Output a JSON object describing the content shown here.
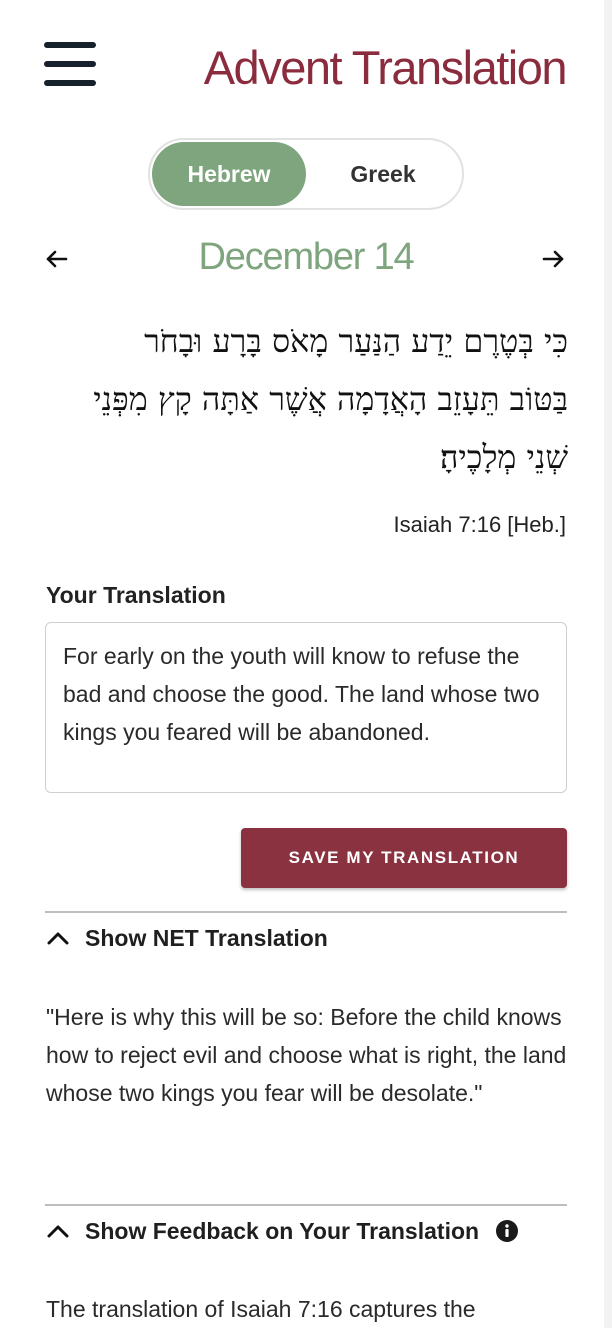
{
  "header": {
    "menu_icon": "hamburger-menu-icon",
    "title": "Advent Translation",
    "title_color": "#8b2c3e"
  },
  "language_toggle": {
    "options": [
      "Hebrew",
      "Greek"
    ],
    "selected": "Hebrew",
    "active_color": "#7ea57e"
  },
  "date_nav": {
    "prev_icon": "arrow-left-icon",
    "next_icon": "arrow-right-icon",
    "date": "December 14",
    "date_color": "#7ea57e"
  },
  "verse": {
    "lines": [
      "כִּי בְּטֶרֶם יֵדַע הַנַּעַר מָאֹס בָּרָע וּבָחֹר",
      "בַּטּוֹב תֵּעָזֵב הָאֲדָמָה אֲשֶׁר אַתָּה קָץ מִפְּנֵי",
      "שְׁנֵי מְלָכֶיהָ׃"
    ],
    "reference": "Isaiah 7:16 [Heb.]"
  },
  "translation": {
    "label": "Your Translation",
    "value": "For early on the youth will know to refuse the bad and choose the good. The land whose two kings you feared will be abandoned."
  },
  "save_button": {
    "label": "SAVE MY TRANSLATION",
    "color": "#8b3241"
  },
  "net_section": {
    "heading": "Show NET Translation",
    "chevron_icon": "chevron-up-icon",
    "text": "\"Here is why this will be so: Before the child knows how to reject evil and choose what is right, the land whose two kings you fear will be desolate.\""
  },
  "feedback_section": {
    "heading": "Show Feedback on Your Translation",
    "chevron_icon": "chevron-up-icon",
    "info_icon": "info-icon",
    "text": "The translation of Isaiah 7:16 captures the"
  }
}
